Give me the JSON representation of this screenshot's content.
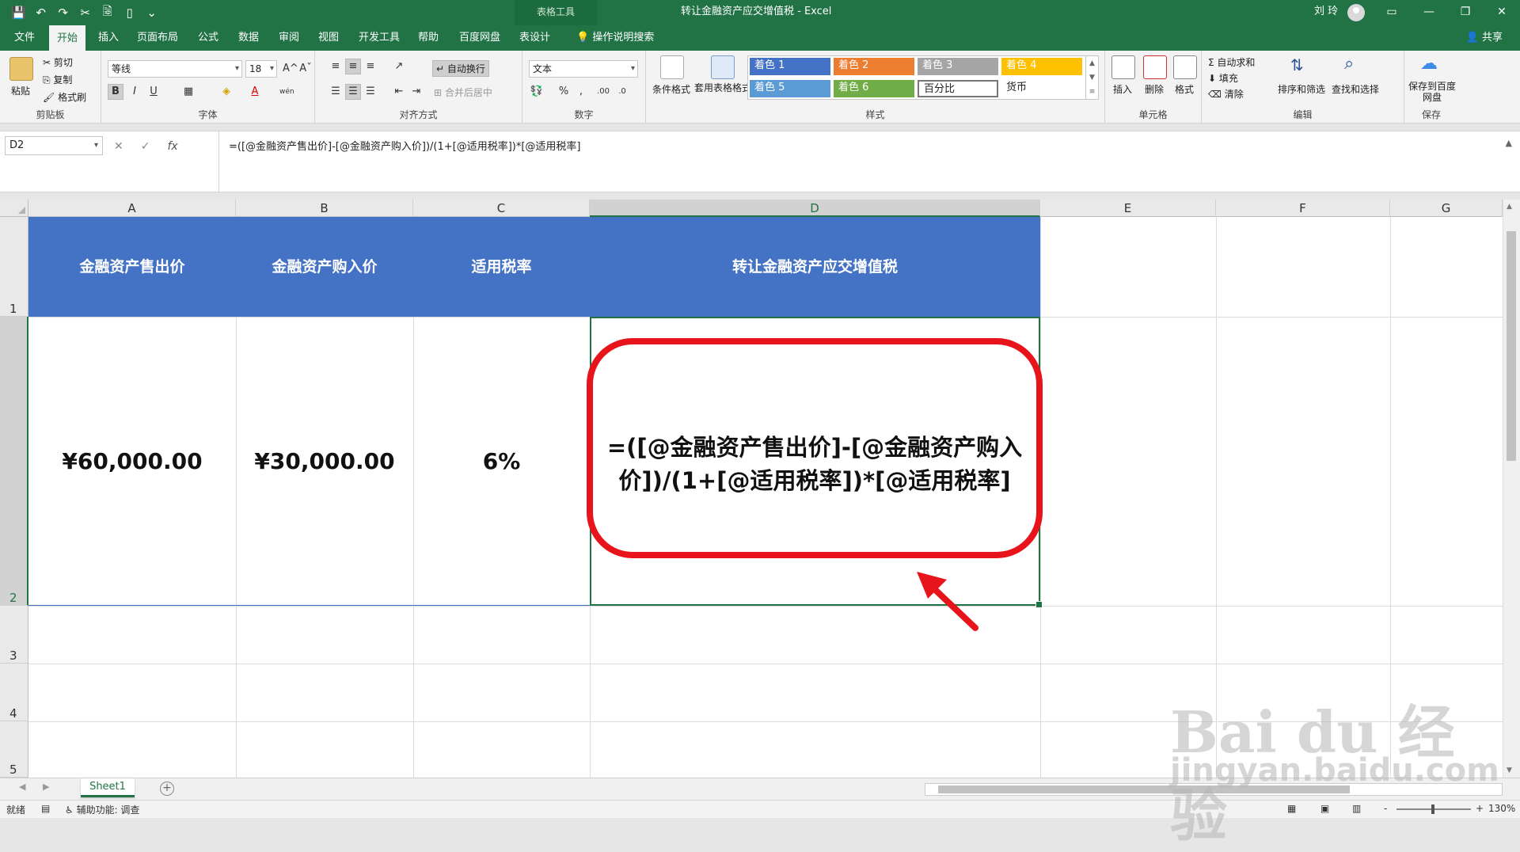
{
  "titlebar": {
    "qat": [
      "💾",
      "↶",
      "↷",
      "✂",
      "🗟",
      "▯",
      "⌄"
    ],
    "table_tools": "表格工具",
    "doc_title": "转让金融资产应交增值税  -  Excel",
    "user": "刘 玲",
    "window_buttons": [
      "▭",
      "—",
      "❐",
      "✕"
    ]
  },
  "tabs": [
    "文件",
    "开始",
    "插入",
    "页面布局",
    "公式",
    "数据",
    "审阅",
    "视图",
    "开发工具",
    "帮助",
    "百度网盘",
    "表设计",
    "操作说明搜索"
  ],
  "active_tab": "开始",
  "share": "共享",
  "ribbon": {
    "clipboard": {
      "paste": "粘贴",
      "cut": "剪切",
      "copy": "复制",
      "format_painter": "格式刷",
      "group": "剪贴板"
    },
    "font": {
      "name": "等线",
      "size": "18",
      "bold": "B",
      "italic": "I",
      "underline": "U",
      "grow": "A^",
      "shrink": "Aˇ",
      "border": "▦",
      "fill": "◈",
      "color": "A",
      "phonetic": "wén",
      "group": "字体"
    },
    "alignment": {
      "wrap": "自动换行",
      "merge": "合并后居中",
      "group": "对齐方式"
    },
    "number": {
      "format": "文本",
      "percent": "%",
      "comma": ",",
      "group": "数字"
    },
    "styles": {
      "conditional": "条件格式",
      "table_format": "套用表格格式",
      "cells": [
        {
          "label": "着色 1",
          "color": "#4472c4"
        },
        {
          "label": "着色 2",
          "color": "#ed7d31"
        },
        {
          "label": "着色 3",
          "color": "#a5a5a5"
        },
        {
          "label": "着色 4",
          "color": "#ffc000"
        },
        {
          "label": "着色 5",
          "color": "#5b9bd5"
        },
        {
          "label": "着色 6",
          "color": "#70ad47"
        },
        {
          "label": "百分比",
          "color": "#ffffff"
        },
        {
          "label": "货币",
          "color": "#ffffff"
        }
      ],
      "group": "样式"
    },
    "cells": {
      "insert": "插入",
      "delete": "删除",
      "format": "格式",
      "group": "单元格"
    },
    "editing": {
      "autosum": "自动求和",
      "fill": "填充",
      "clear": "清除",
      "sort": "排序和筛选",
      "find": "查找和选择",
      "group": "编辑"
    },
    "save": {
      "label": "保存到百度网盘",
      "group": "保存"
    }
  },
  "formula_bar": {
    "name_box": "D2",
    "cancel": "✕",
    "enter": "✓",
    "fx": "fx",
    "formula": "=([@金融资产售出价]-[@金融资产购入价])/(1+[@适用税率])*[@适用税率]"
  },
  "columns": [
    "A",
    "B",
    "C",
    "D",
    "E",
    "F",
    "G"
  ],
  "rows": [
    "1",
    "2",
    "3",
    "4",
    "5"
  ],
  "table": {
    "headers": [
      "金融资产售出价",
      "金融资产购入价",
      "适用税率",
      "转让金融资产应交增值税"
    ],
    "row2": [
      "¥60,000.00",
      "¥30,000.00",
      "6%"
    ],
    "d2_display": "=([@金融资产售出价]-[@金融资产购入价])/(1+[@适用税率])*[@适用税率]",
    "header_color": "#4472c4"
  },
  "callout_color": "#e8141b",
  "sheet_tab": "Sheet1",
  "add_sheet": "+",
  "statusbar": {
    "ready": "就绪",
    "accessibility": "辅助功能: 调查",
    "zoom": "130%",
    "zoom_minus": "-",
    "zoom_plus": "+"
  },
  "watermark": {
    "logo": "Bai du 经验",
    "url": "jingyan.baidu.com"
  }
}
